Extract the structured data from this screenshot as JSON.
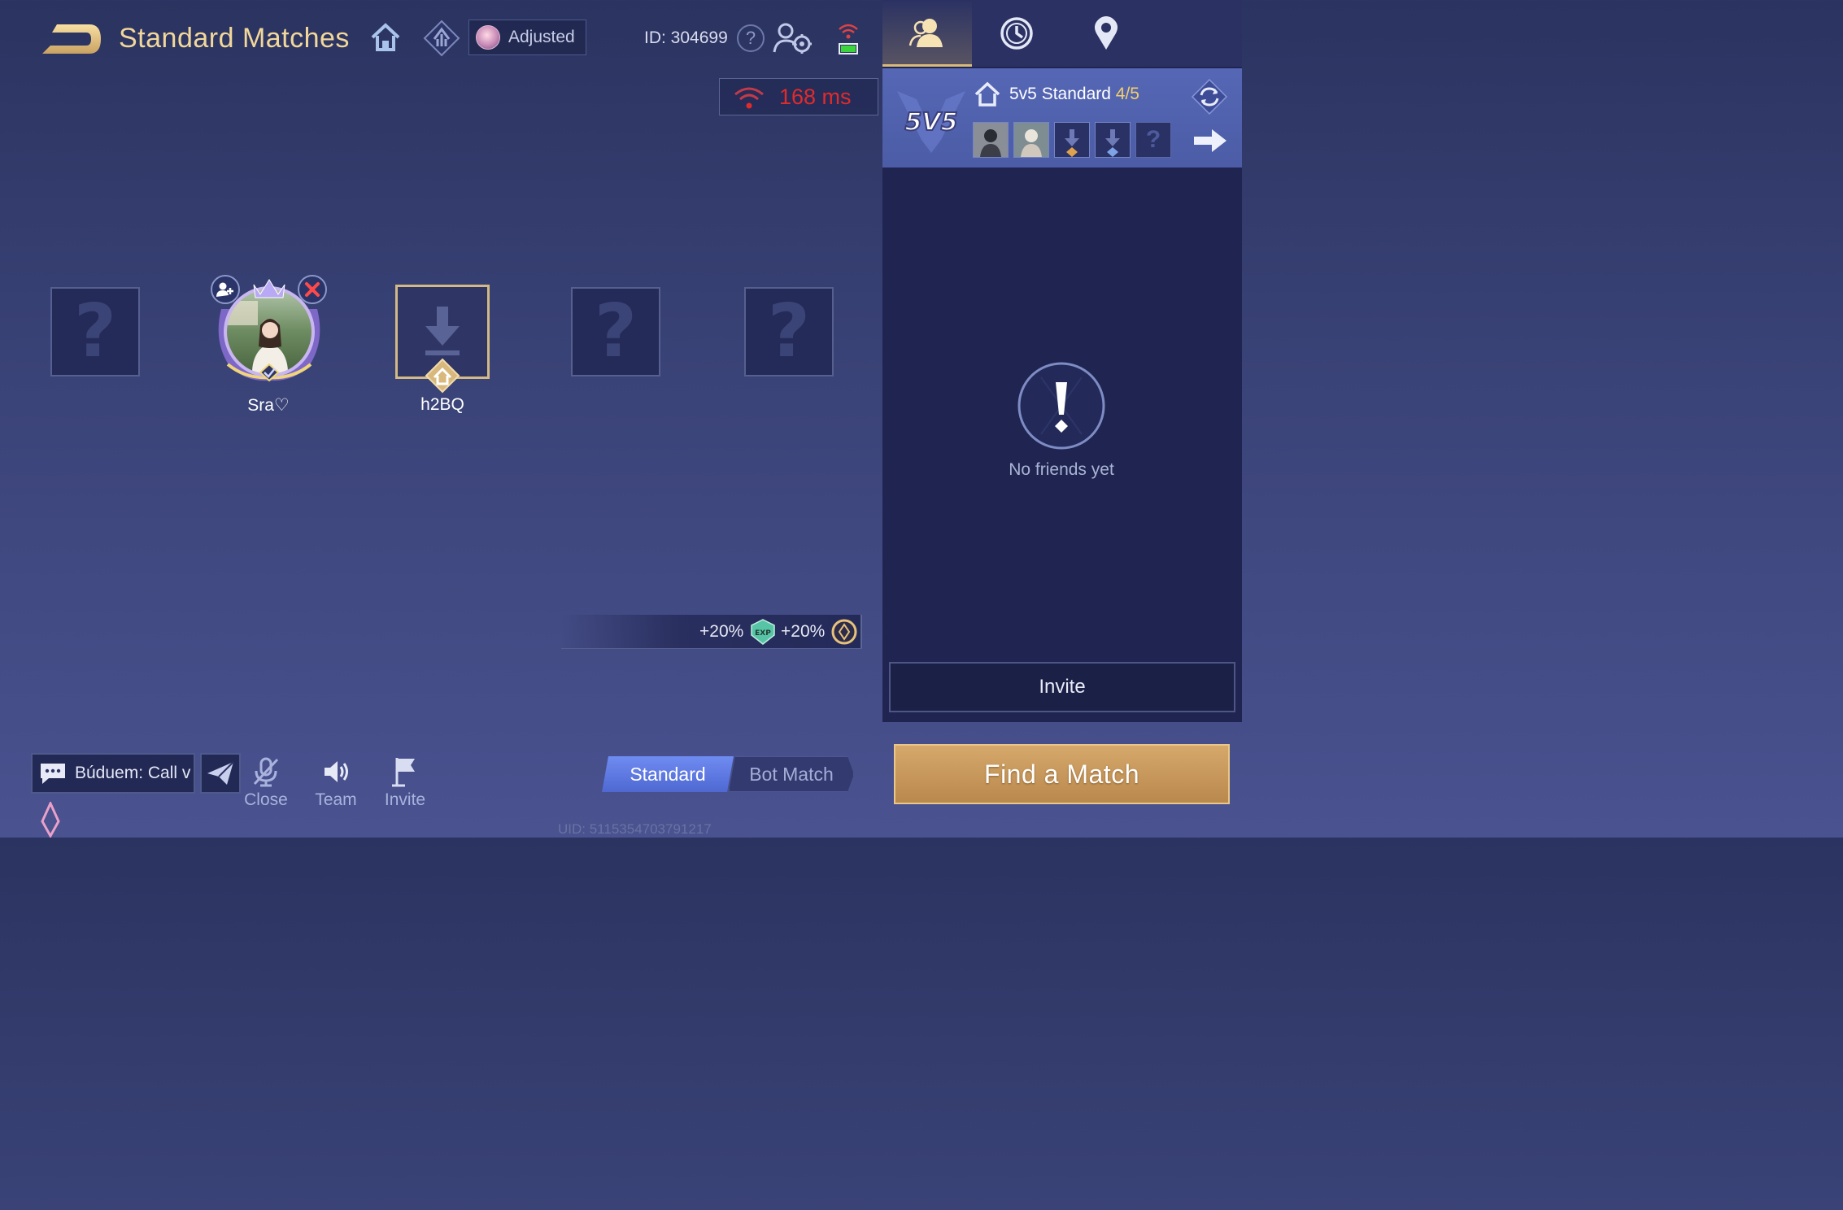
{
  "header": {
    "title": "Standard Matches",
    "adjusted_label": "Adjusted",
    "player_id": "ID: 304699",
    "help_label": "?"
  },
  "network": {
    "ping": "168 ms"
  },
  "lobby": {
    "slots": [
      {
        "state": "empty",
        "label": "?"
      },
      {
        "state": "player",
        "name": "Sra♡"
      },
      {
        "state": "downloading",
        "name": "h2BQ"
      },
      {
        "state": "empty",
        "label": "?"
      },
      {
        "state": "empty",
        "label": "?"
      }
    ]
  },
  "bonus": {
    "exp": "+20%",
    "coin": "+20%"
  },
  "bottom": {
    "chat_preview": "Búduem: Call v",
    "mic_label": "Close",
    "speaker_label": "Team",
    "invite_label": "Invite",
    "uid": "UID: 5115354703791217"
  },
  "mode_toggle": {
    "standard": "Standard",
    "bot": "Bot Match",
    "selected": "Standard"
  },
  "right_panel": {
    "tabs": [
      "friends-icon",
      "history-icon",
      "location-icon"
    ],
    "active_tab": 0,
    "room": {
      "title": "5v5 Standard ",
      "count": "4/5",
      "empty_slot_label": "?"
    },
    "empty_message": "No friends yet",
    "invite_button": "Invite"
  },
  "find_match": "Find a Match",
  "colors": {
    "title_gold": "#f1d79a",
    "ping_red": "#e02b2b",
    "accent_blue": "#5f7ae6",
    "find_button": "#c99a5c"
  }
}
